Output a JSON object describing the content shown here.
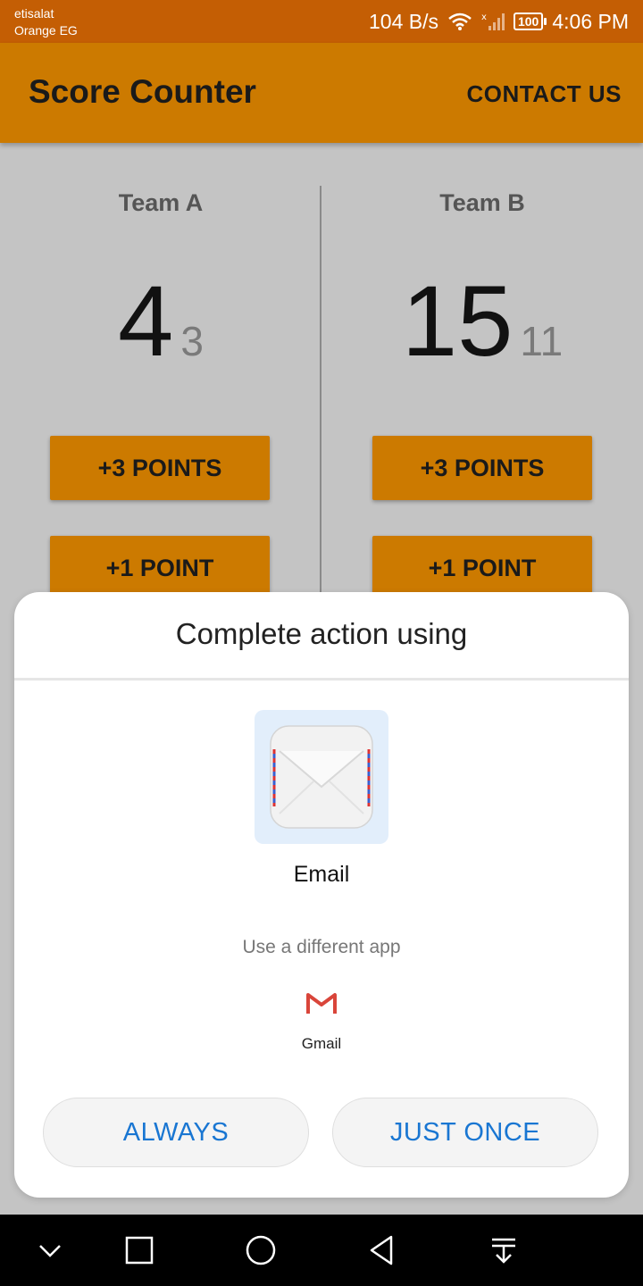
{
  "status_bar": {
    "carrier_line1": "etisalat",
    "carrier_line2": "Orange EG",
    "speed": "104 B/s",
    "battery": "100",
    "time": "4:06 PM",
    "icons": [
      "wifi-icon",
      "signal-icon",
      "battery-icon"
    ]
  },
  "app_bar": {
    "title": "Score Counter",
    "contact_label": "CONTACT US",
    "color": "#cc7a00"
  },
  "teams": [
    {
      "name": "Team A",
      "score": "4",
      "sub_score": "3",
      "btn_three": "+3 POINTS",
      "btn_one": "+1 POINT"
    },
    {
      "name": "Team B",
      "score": "15",
      "sub_score": "11",
      "btn_three": "+3 POINTS",
      "btn_one": "+1 POINT"
    }
  ],
  "dialog": {
    "title": "Complete action using",
    "primary_app": {
      "label": "Email",
      "icon": "envelope-icon"
    },
    "different_app_label": "Use a different app",
    "other_app": {
      "label": "Gmail",
      "icon": "gmail-icon"
    },
    "always_label": "ALWAYS",
    "just_once_label": "JUST ONCE",
    "accent_color": "#1976d2"
  },
  "nav_bar": {
    "icons": [
      "collapse-icon",
      "recents-icon",
      "home-icon",
      "back-icon",
      "notification-pull-icon"
    ]
  }
}
